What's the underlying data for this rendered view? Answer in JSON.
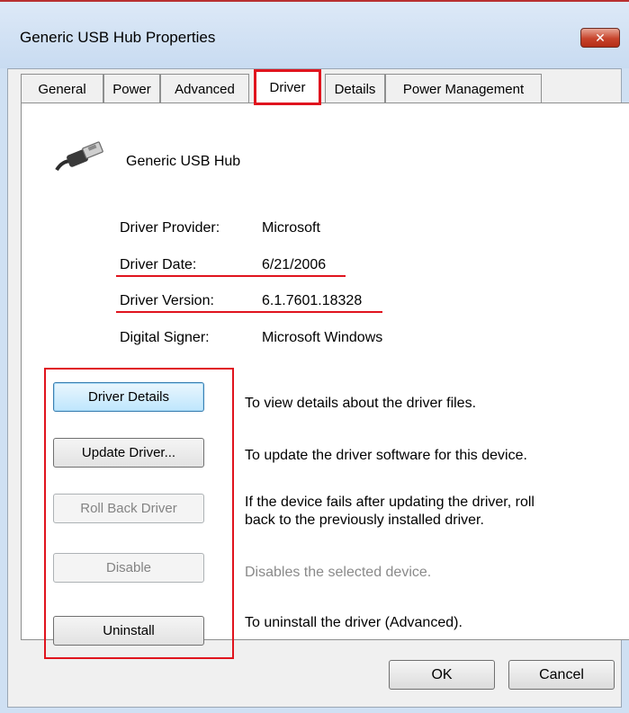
{
  "window": {
    "title": "Generic USB Hub Properties",
    "close_glyph": "✕"
  },
  "tabs": [
    {
      "label": "General"
    },
    {
      "label": "Power"
    },
    {
      "label": "Advanced"
    },
    {
      "label": "Driver"
    },
    {
      "label": "Details"
    },
    {
      "label": "Power Management"
    }
  ],
  "active_tab": "Driver",
  "device": {
    "name": "Generic USB Hub",
    "icon": "usb-cable-icon"
  },
  "info": {
    "provider_label": "Driver Provider:",
    "provider_value": "Microsoft",
    "date_label": "Driver Date:",
    "date_value": "6/21/2006",
    "version_label": "Driver Version:",
    "version_value": "6.1.7601.18328",
    "signer_label": "Digital Signer:",
    "signer_value": "Microsoft Windows"
  },
  "actions": {
    "details_label": "Driver Details",
    "details_desc": "To view details about the driver files.",
    "update_label": "Update Driver...",
    "update_desc": "To update the driver software for this device.",
    "rollback_label": "Roll Back Driver",
    "rollback_desc_line1": "If the device fails after updating the driver, roll",
    "rollback_desc_line2": "back to the previously installed driver.",
    "disable_label": "Disable",
    "disable_desc": "Disables the selected device.",
    "uninstall_label": "Uninstall",
    "uninstall_desc": "To uninstall the driver (Advanced)."
  },
  "footer": {
    "ok_label": "OK",
    "cancel_label": "Cancel"
  },
  "colors": {
    "highlight_red": "#e0141e",
    "title_bar": "#cfe0f3",
    "panel": "#ffffff"
  }
}
